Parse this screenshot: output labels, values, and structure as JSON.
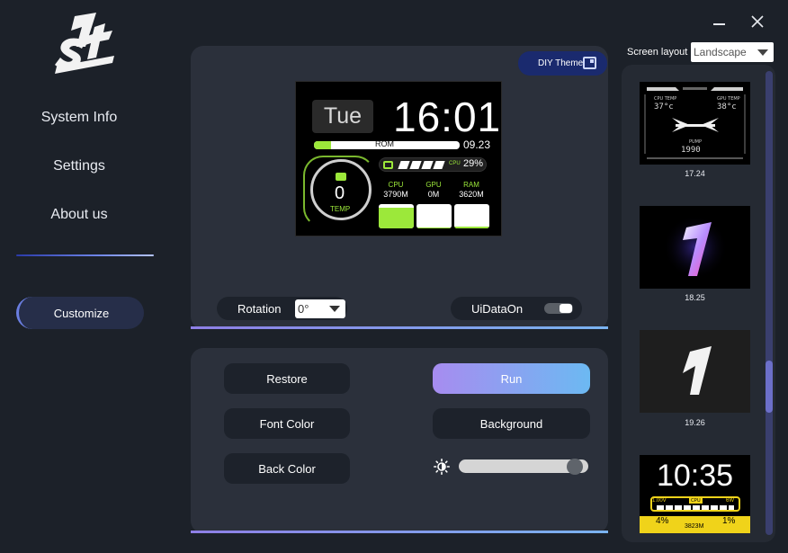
{
  "brand": {
    "logo_text": "1st PLAYER"
  },
  "window": {
    "minimize_icon": "minimize-icon",
    "close_icon": "close-icon"
  },
  "sidebar": {
    "items": [
      {
        "label": "System Info"
      },
      {
        "label": "Settings"
      },
      {
        "label": "About us"
      }
    ],
    "customize_label": "Customize"
  },
  "preview": {
    "diy_theme_label": "DIY Theme",
    "screen": {
      "day": "Tue",
      "time": "16:01",
      "rom_label": "ROM",
      "rom_value": "09.23",
      "rom_fill": 0.12,
      "cpu_label": "CPU",
      "cpu_pct": "29%",
      "temp_value": "0",
      "temp_label": "TEMP",
      "columns": [
        {
          "name": "CPU",
          "value": "3790M",
          "fill": 0.85
        },
        {
          "name": "GPU",
          "value": "0M",
          "fill": 0.05
        },
        {
          "name": "RAM",
          "value": "3620M",
          "fill": 0.08
        }
      ],
      "accent": "#9ce83a"
    },
    "rotation_label": "Rotation",
    "rotation_value": "0°",
    "uidata_label": "UiDataOn",
    "uidata_on": true
  },
  "controls": {
    "restore_label": "Restore",
    "run_label": "Run",
    "font_color_label": "Font Color",
    "background_label": "Background",
    "back_color_label": "Back Color",
    "brightness": 0.95
  },
  "layout": {
    "label": "Screen layout",
    "selected": "Landscape",
    "thumbnails": [
      {
        "caption": "17.24"
      },
      {
        "caption": "18.25"
      },
      {
        "caption": "19.26"
      },
      {
        "caption": "",
        "time": "10:35",
        "voltage": "1.00V",
        "watt": "6W",
        "cpu": "CPU",
        "pct_left": "4%",
        "pct_right": "1%",
        "freq": "3823M"
      }
    ]
  },
  "colors": {
    "background": "#1c2129",
    "panel": "#2b303b",
    "accent_purple": "#a78cf0",
    "accent_blue": "#6cb9f2"
  }
}
